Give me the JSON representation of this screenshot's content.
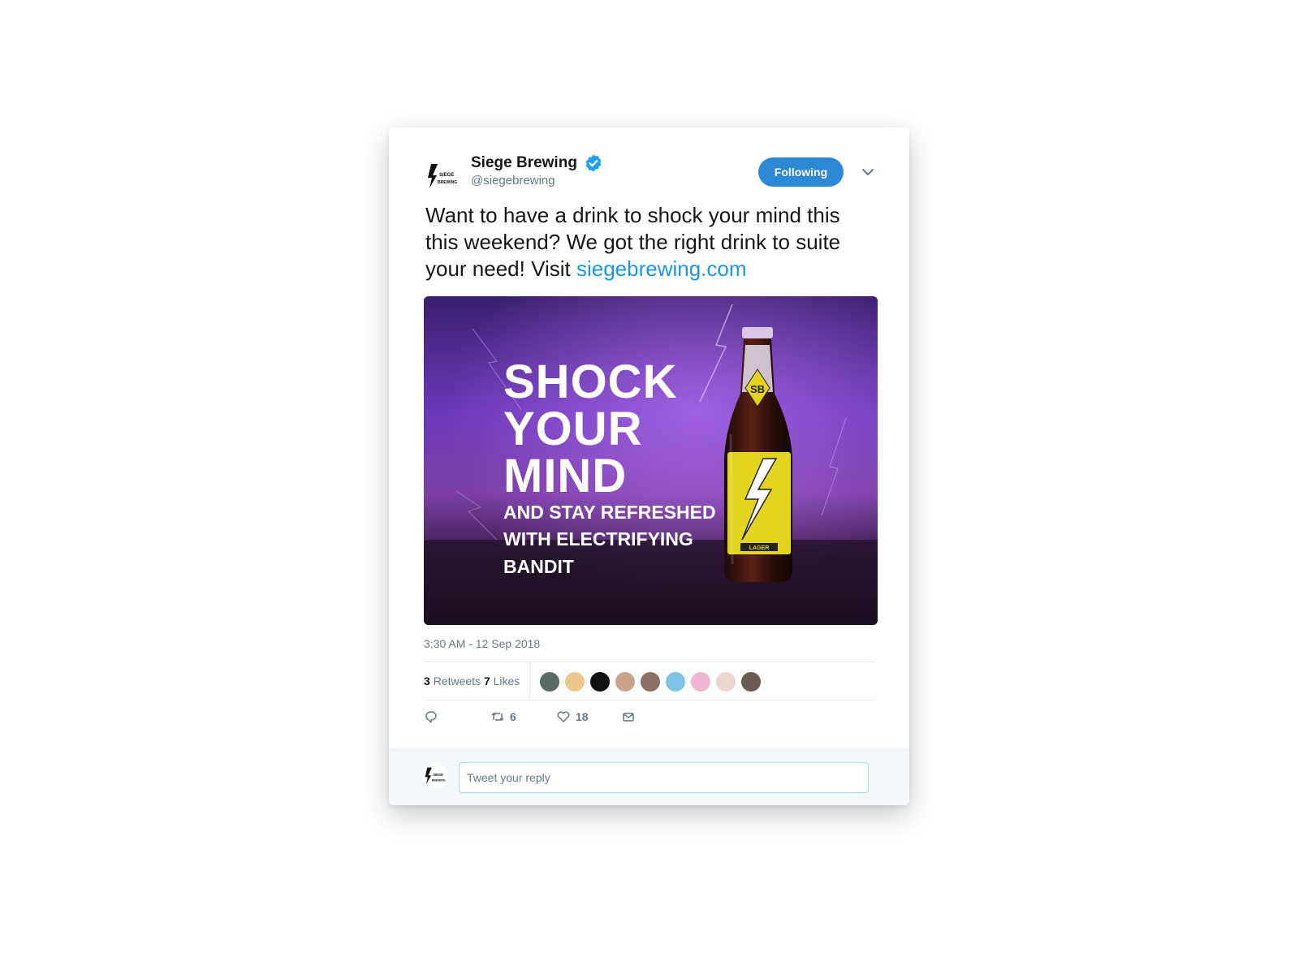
{
  "account": {
    "name": "Siege Brewing",
    "handle": "@siegebrewing",
    "verified": true,
    "logo_text_top": "SIEGE",
    "logo_text_bottom": "BREWING"
  },
  "follow_button": {
    "label": "Following"
  },
  "tweet": {
    "text": "Want to have a drink to shock your mind this this weekend? We got the right drink to suite your need! Visit ",
    "link_text": "siegebrewing.com",
    "timestamp": "3:30 AM - 12 Sep 2018"
  },
  "media": {
    "headline_lines": [
      "SHOCK",
      "YOUR",
      "MIND"
    ],
    "subline_lines": [
      "AND STAY REFRESHED",
      "WITH ELECTRIFYING",
      "BANDIT"
    ],
    "bottle_monogram": "SB",
    "bottle_label_text": "LAGER"
  },
  "stats": {
    "retweets_count": "3",
    "retweets_label": "Retweets",
    "likes_count": "7",
    "likes_label": "Likes",
    "liker_avatar_colors": [
      "#5a6b63",
      "#e9c98a",
      "#111111",
      "#c9a38a",
      "#8a6f66",
      "#7fc4e8",
      "#f0b6d2",
      "#e8d6cf",
      "#6b5a54"
    ]
  },
  "actions": {
    "reply_count": "",
    "retweet_count": "6",
    "like_count": "18"
  },
  "reply": {
    "placeholder": "Tweet your reply"
  },
  "colors": {
    "accent": "#2d88d6",
    "link": "#1b95e0",
    "verified": "#1da1f2",
    "secondary_text": "#657786"
  }
}
